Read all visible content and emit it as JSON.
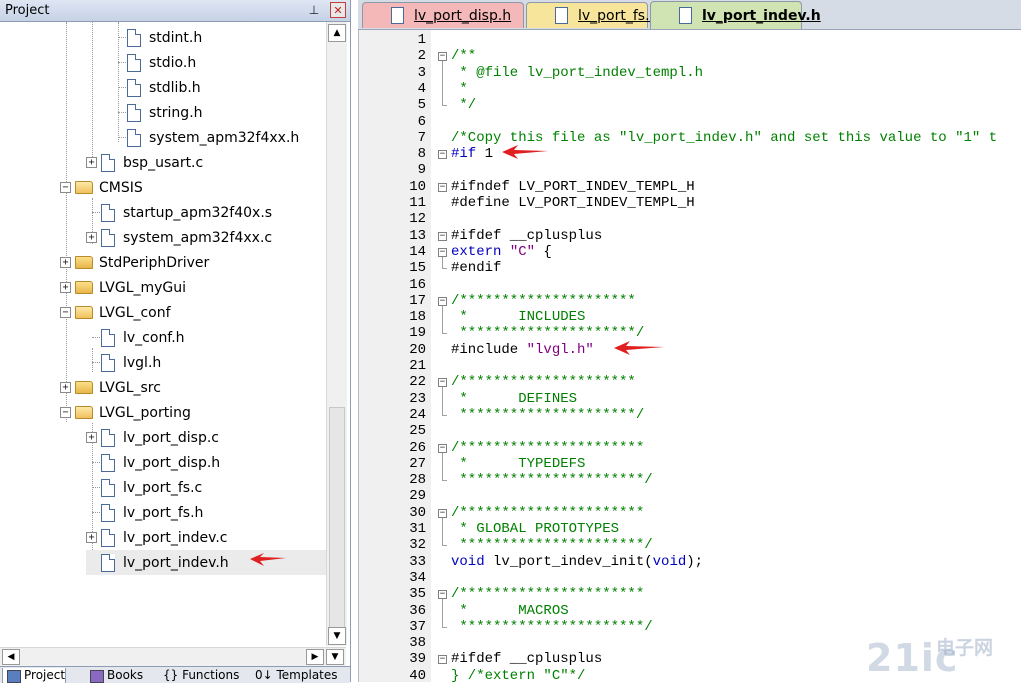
{
  "project_panel": {
    "title": "Project",
    "pin_glyph": "⊥",
    "close_glyph": "✕",
    "tree": [
      {
        "label": "stdint.h",
        "type": "file",
        "depth": 4,
        "expander": "none"
      },
      {
        "label": "stdio.h",
        "type": "file",
        "depth": 4,
        "expander": "none"
      },
      {
        "label": "stdlib.h",
        "type": "file",
        "depth": 4,
        "expander": "none"
      },
      {
        "label": "string.h",
        "type": "file",
        "depth": 4,
        "expander": "none"
      },
      {
        "label": "system_apm32f4xx.h",
        "type": "file",
        "depth": 4,
        "expander": "none"
      },
      {
        "label": "bsp_usart.c",
        "type": "file",
        "depth": 3,
        "expander": "plus"
      },
      {
        "label": "CMSIS",
        "type": "folder-open",
        "depth": 2,
        "expander": "minus"
      },
      {
        "label": "startup_apm32f40x.s",
        "type": "file",
        "depth": 3,
        "expander": "none"
      },
      {
        "label": "system_apm32f4xx.c",
        "type": "file",
        "depth": 3,
        "expander": "plus"
      },
      {
        "label": "StdPeriphDriver",
        "type": "folder",
        "depth": 2,
        "expander": "plus"
      },
      {
        "label": "LVGL_myGui",
        "type": "folder",
        "depth": 2,
        "expander": "plus"
      },
      {
        "label": "LVGL_conf",
        "type": "folder-open",
        "depth": 2,
        "expander": "minus"
      },
      {
        "label": "lv_conf.h",
        "type": "file",
        "depth": 3,
        "expander": "none"
      },
      {
        "label": "lvgl.h",
        "type": "file",
        "depth": 3,
        "expander": "none"
      },
      {
        "label": "LVGL_src",
        "type": "folder",
        "depth": 2,
        "expander": "plus"
      },
      {
        "label": "LVGL_porting",
        "type": "folder-open",
        "depth": 2,
        "expander": "minus"
      },
      {
        "label": "lv_port_disp.c",
        "type": "file",
        "depth": 3,
        "expander": "plus"
      },
      {
        "label": "lv_port_disp.h",
        "type": "file",
        "depth": 3,
        "expander": "none"
      },
      {
        "label": "lv_port_fs.c",
        "type": "file",
        "depth": 3,
        "expander": "none"
      },
      {
        "label": "lv_port_fs.h",
        "type": "file",
        "depth": 3,
        "expander": "none"
      },
      {
        "label": "lv_port_indev.c",
        "type": "file",
        "depth": 3,
        "expander": "plus"
      },
      {
        "label": "lv_port_indev.h",
        "type": "file",
        "depth": 3,
        "expander": "none",
        "selected": true
      }
    ],
    "bottom_tabs": [
      "Project",
      "Books",
      "{} Functions",
      "0↓ Templates"
    ]
  },
  "editor": {
    "tabs": [
      {
        "label": "lv_port_disp.h",
        "color": "#f4b8b8",
        "active": false
      },
      {
        "label": "lv_port_fs.h",
        "color": "#f6e59a",
        "active": false
      },
      {
        "label": "lv_port_indev.h",
        "color": "#cfe3b3",
        "active": true
      }
    ],
    "lines": [
      {
        "n": "1",
        "fold": "",
        "segs": []
      },
      {
        "n": "2",
        "fold": "minus",
        "segs": [
          {
            "c": "comment",
            "t": "/**"
          }
        ]
      },
      {
        "n": "3",
        "fold": "",
        "segs": [
          {
            "c": "comment",
            "t": " * @file lv_port_indev_templ.h"
          }
        ]
      },
      {
        "n": "4",
        "fold": "",
        "segs": [
          {
            "c": "comment",
            "t": " *"
          }
        ]
      },
      {
        "n": "5",
        "fold": "end",
        "segs": [
          {
            "c": "comment",
            "t": " */"
          }
        ]
      },
      {
        "n": "6",
        "fold": "",
        "segs": []
      },
      {
        "n": "7",
        "fold": "",
        "segs": [
          {
            "c": "comment",
            "t": "/*Copy this file as \"lv_port_indev.h\" and set this value to \"1\" t"
          }
        ]
      },
      {
        "n": "8",
        "fold": "minus",
        "segs": [
          {
            "c": "kw",
            "t": "#if "
          },
          {
            "c": "num",
            "t": "1"
          }
        ]
      },
      {
        "n": "9",
        "fold": "",
        "segs": []
      },
      {
        "n": "10",
        "fold": "minus",
        "segs": [
          {
            "c": "pre",
            "t": "#ifndef LV_PORT_INDEV_TEMPL_H"
          }
        ]
      },
      {
        "n": "11",
        "fold": "",
        "segs": [
          {
            "c": "pre",
            "t": "#define LV_PORT_INDEV_TEMPL_H"
          }
        ]
      },
      {
        "n": "12",
        "fold": "",
        "segs": []
      },
      {
        "n": "13",
        "fold": "minus",
        "segs": [
          {
            "c": "pre",
            "t": "#ifdef __cplusplus"
          }
        ]
      },
      {
        "n": "14",
        "fold": "minus",
        "segs": [
          {
            "c": "kw",
            "t": "extern "
          },
          {
            "c": "str",
            "t": "\"C\""
          },
          {
            "c": "text",
            "t": " {"
          }
        ]
      },
      {
        "n": "15",
        "fold": "end",
        "segs": [
          {
            "c": "pre",
            "t": "#endif"
          }
        ]
      },
      {
        "n": "16",
        "fold": "",
        "segs": []
      },
      {
        "n": "17",
        "fold": "minus",
        "segs": [
          {
            "c": "comment",
            "t": "/*********************"
          }
        ]
      },
      {
        "n": "18",
        "fold": "",
        "segs": [
          {
            "c": "comment",
            "t": " *      INCLUDES"
          }
        ]
      },
      {
        "n": "19",
        "fold": "end",
        "segs": [
          {
            "c": "comment",
            "t": " *********************/"
          }
        ]
      },
      {
        "n": "20",
        "fold": "",
        "segs": [
          {
            "c": "pre",
            "t": "#include "
          },
          {
            "c": "str",
            "t": "\"lvgl.h\""
          }
        ]
      },
      {
        "n": "21",
        "fold": "",
        "segs": []
      },
      {
        "n": "22",
        "fold": "minus",
        "segs": [
          {
            "c": "comment",
            "t": "/*********************"
          }
        ]
      },
      {
        "n": "23",
        "fold": "",
        "segs": [
          {
            "c": "comment",
            "t": " *      DEFINES"
          }
        ]
      },
      {
        "n": "24",
        "fold": "end",
        "segs": [
          {
            "c": "comment",
            "t": " *********************/"
          }
        ]
      },
      {
        "n": "25",
        "fold": "",
        "segs": []
      },
      {
        "n": "26",
        "fold": "minus",
        "segs": [
          {
            "c": "comment",
            "t": "/**********************"
          }
        ]
      },
      {
        "n": "27",
        "fold": "",
        "segs": [
          {
            "c": "comment",
            "t": " *      TYPEDEFS"
          }
        ]
      },
      {
        "n": "28",
        "fold": "end",
        "segs": [
          {
            "c": "comment",
            "t": " **********************/"
          }
        ]
      },
      {
        "n": "29",
        "fold": "",
        "segs": []
      },
      {
        "n": "30",
        "fold": "minus",
        "segs": [
          {
            "c": "comment",
            "t": "/**********************"
          }
        ]
      },
      {
        "n": "31",
        "fold": "",
        "segs": [
          {
            "c": "comment",
            "t": " * GLOBAL PROTOTYPES"
          }
        ]
      },
      {
        "n": "32",
        "fold": "end",
        "segs": [
          {
            "c": "comment",
            "t": " **********************/"
          }
        ]
      },
      {
        "n": "33",
        "fold": "",
        "segs": [
          {
            "c": "kw",
            "t": "void"
          },
          {
            "c": "text",
            "t": " lv_port_indev_init("
          },
          {
            "c": "kw",
            "t": "void"
          },
          {
            "c": "text",
            "t": ");"
          }
        ]
      },
      {
        "n": "34",
        "fold": "",
        "segs": []
      },
      {
        "n": "35",
        "fold": "minus",
        "segs": [
          {
            "c": "comment",
            "t": "/**********************"
          }
        ]
      },
      {
        "n": "36",
        "fold": "",
        "segs": [
          {
            "c": "comment",
            "t": " *      MACROS"
          }
        ]
      },
      {
        "n": "37",
        "fold": "end",
        "segs": [
          {
            "c": "comment",
            "t": " **********************/"
          }
        ]
      },
      {
        "n": "38",
        "fold": "",
        "segs": []
      },
      {
        "n": "39",
        "fold": "minus",
        "segs": [
          {
            "c": "pre",
            "t": "#ifdef __cplusplus"
          }
        ]
      },
      {
        "n": "40",
        "fold": "",
        "segs": [
          {
            "c": "comment",
            "t": "} /*extern \"C\"*/"
          }
        ]
      }
    ]
  },
  "watermark": {
    "main": "21ic",
    "sub_top": "电子网"
  },
  "colors": {
    "annotation_arrow": "#e02020"
  }
}
